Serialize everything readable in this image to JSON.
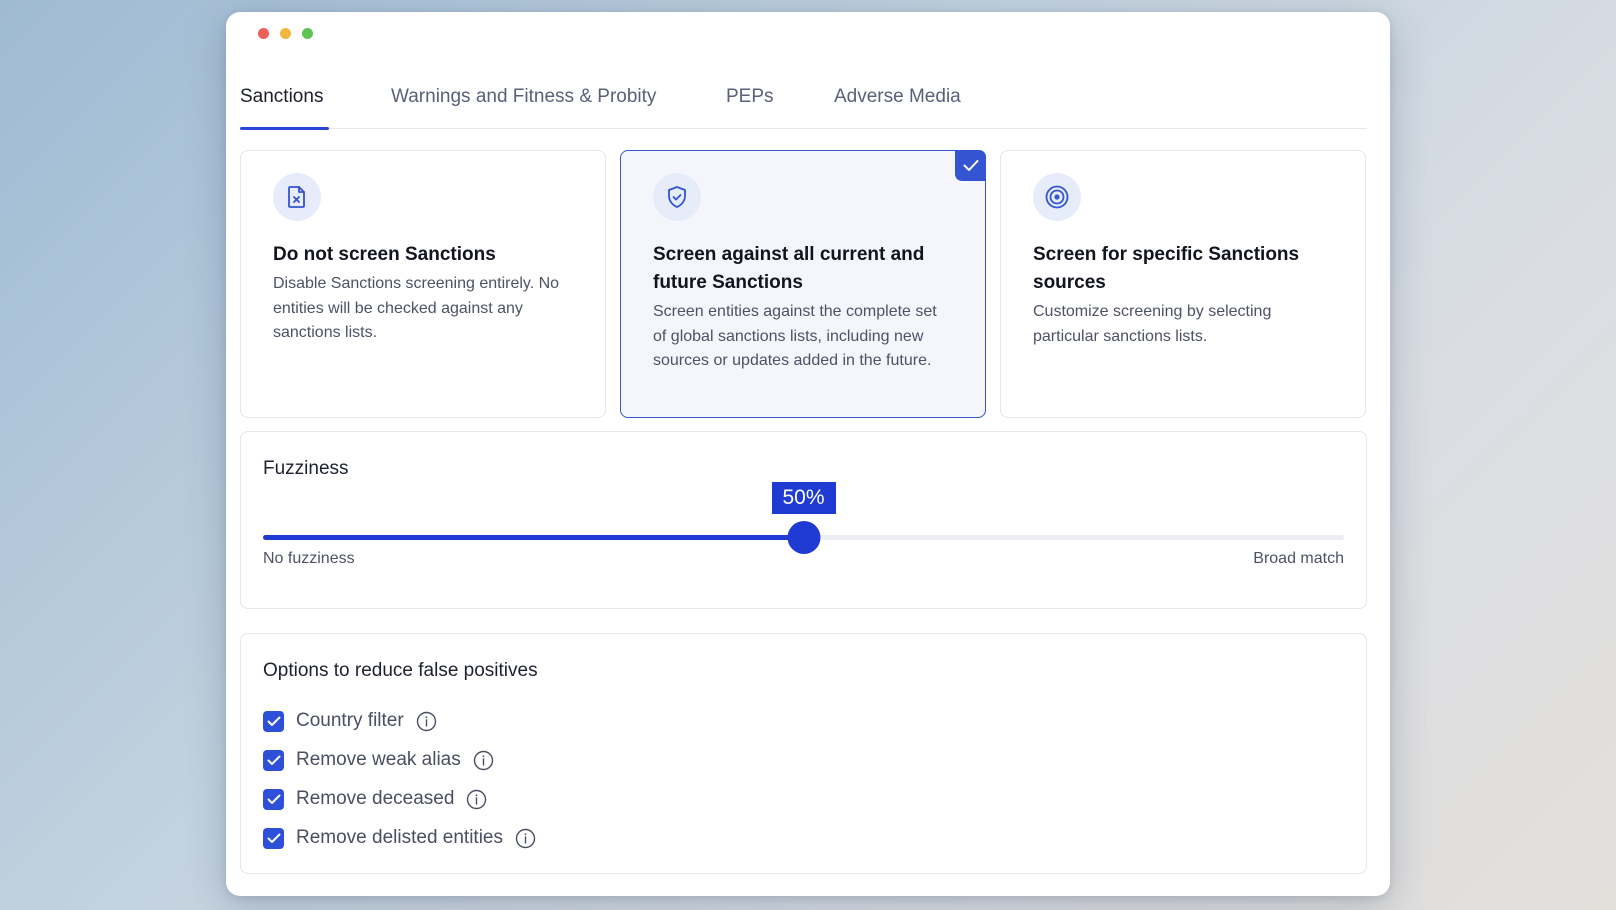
{
  "tabs": [
    {
      "label": "Sanctions"
    },
    {
      "label": "Warnings and Fitness & Probity"
    },
    {
      "label": "PEPs"
    },
    {
      "label": "Adverse Media"
    }
  ],
  "active_tab": "Sanctions",
  "cards": [
    {
      "icon": "file-x-icon",
      "title": "Do not screen Sanctions",
      "description": "Disable Sanctions screening entirely. No entities will be checked against any sanctions lists.",
      "selected": false
    },
    {
      "icon": "shield-check-icon",
      "title": "Screen against all current and future Sanctions",
      "description": "Screen entities against the complete set of global sanctions lists, including new sources or updates added in the future.",
      "selected": true
    },
    {
      "icon": "target-icon",
      "title": "Screen for specific Sanctions sources",
      "description": "Customize screening by selecting particular sanctions lists.",
      "selected": false
    }
  ],
  "fuzziness": {
    "title": "Fuzziness",
    "value": 50,
    "value_label": "50%",
    "min_label": "No fuzziness",
    "max_label": "Broad match"
  },
  "false_positives": {
    "title": "Options to reduce false positives",
    "options": [
      {
        "label": "Country filter",
        "checked": true
      },
      {
        "label": "Remove weak alias",
        "checked": true
      },
      {
        "label": "Remove deceased",
        "checked": true
      },
      {
        "label": "Remove delisted entities",
        "checked": true
      }
    ]
  },
  "colors": {
    "accent": "#1f3bd3",
    "selected_card_bg": "#f4f6fc",
    "icon_bg": "#e7ecfb"
  }
}
